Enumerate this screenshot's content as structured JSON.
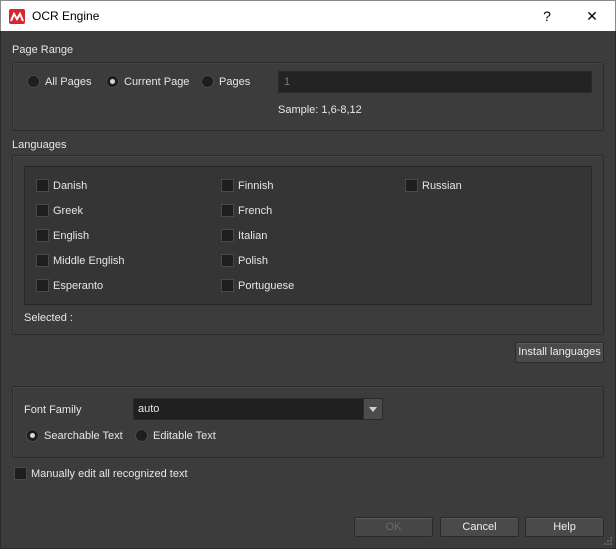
{
  "window": {
    "title": "OCR Engine",
    "help_glyph": "?",
    "close_glyph": "✕"
  },
  "page_range": {
    "heading": "Page Range",
    "options": [
      {
        "label": "All Pages",
        "checked": false
      },
      {
        "label": "Current Page",
        "checked": true
      },
      {
        "label": "Pages",
        "checked": false
      }
    ],
    "pages_input_value": "1",
    "sample_text": "Sample: 1,6-8,12"
  },
  "languages": {
    "heading": "Languages",
    "items": [
      {
        "label": "Danish",
        "checked": false
      },
      {
        "label": "Greek",
        "checked": false
      },
      {
        "label": "English",
        "checked": false
      },
      {
        "label": "Middle English",
        "checked": false
      },
      {
        "label": "Esperanto",
        "checked": false
      },
      {
        "label": "Finnish",
        "checked": false
      },
      {
        "label": "French",
        "checked": false
      },
      {
        "label": "Italian",
        "checked": false
      },
      {
        "label": "Polish",
        "checked": false
      },
      {
        "label": "Portuguese",
        "checked": false
      },
      {
        "label": "Russian",
        "checked": false
      }
    ],
    "selected_label": "Selected :",
    "install_button": "Install languages"
  },
  "output": {
    "font_family_label": "Font Family",
    "font_family_value": "auto",
    "modes": [
      {
        "label": "Searchable Text",
        "checked": true
      },
      {
        "label": "Editable Text",
        "checked": false
      }
    ]
  },
  "manual_edit": {
    "label": "Manually edit all recognized text",
    "checked": false
  },
  "footer": {
    "ok": "OK",
    "cancel": "Cancel",
    "help": "Help"
  },
  "colors": {
    "background": "#3c3c3c",
    "title_bar": "#ffffff",
    "app_icon": "#d9262c",
    "text": "#e6e6e6"
  },
  "icons": {
    "app": "app-logo-icon",
    "help": "help-icon",
    "close": "close-icon",
    "dropdown": "chevron-down-icon"
  }
}
